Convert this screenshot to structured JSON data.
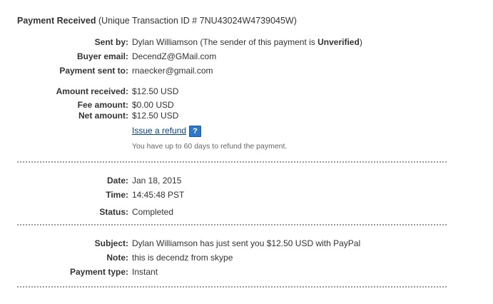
{
  "header": {
    "title": "Payment Received",
    "transaction": "(Unique Transaction ID # 7NU43024W4739045W)"
  },
  "sender": {
    "label": "Sent by:",
    "name": "Dylan Williamson",
    "note_prefix": "(The sender of this payment is ",
    "status": "Unverified",
    "note_suffix": ")"
  },
  "buyer_email": {
    "label": "Buyer email:",
    "value": "DecendZ@GMail.com"
  },
  "payment_sent_to": {
    "label": "Payment sent to:",
    "value": "rnaecker@gmail.com"
  },
  "amount_received": {
    "label": "Amount received:",
    "value": "$12.50 USD"
  },
  "fee_amount": {
    "label": "Fee amount:",
    "value": "$0.00 USD"
  },
  "net_amount": {
    "label": "Net amount:",
    "value": "$12.50 USD"
  },
  "refund": {
    "link_label": "Issue a refund",
    "help_icon": "?",
    "note": "You have up to 60 days to refund the payment."
  },
  "date": {
    "label": "Date:",
    "value": "Jan 18, 2015"
  },
  "time": {
    "label": "Time:",
    "value": "14:45:48 PST"
  },
  "status": {
    "label": "Status:",
    "value": "Completed"
  },
  "subject": {
    "label": "Subject:",
    "value": "Dylan Williamson has just sent you $12.50 USD with PayPal"
  },
  "note": {
    "label": "Note:",
    "value": "this is decendz from skype"
  },
  "payment_type": {
    "label": "Payment type:",
    "value": "Instant"
  },
  "colors": {
    "link": "#084482",
    "help_icon": "#2f78c8",
    "text": "#333333",
    "muted": "#666666"
  },
  "icons": {
    "help": "help-question-icon"
  }
}
